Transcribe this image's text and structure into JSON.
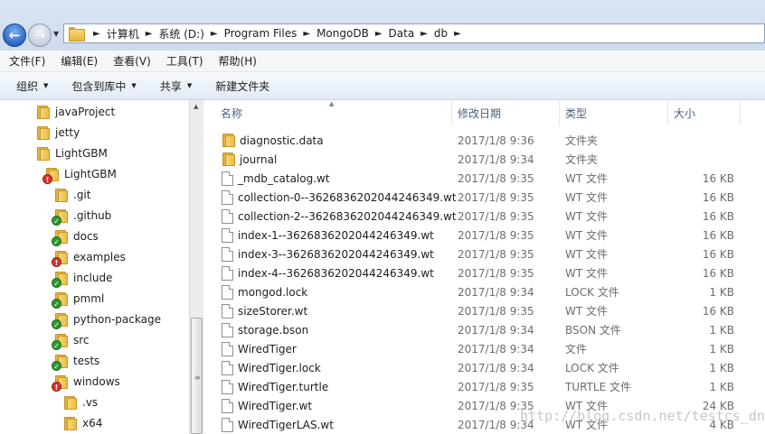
{
  "address": {
    "crumbs": [
      "计算机",
      "系统 (D:)",
      "Program Files",
      "MongoDB",
      "Data",
      "db"
    ]
  },
  "menu": [
    "文件(F)",
    "编辑(E)",
    "查看(V)",
    "工具(T)",
    "帮助(H)"
  ],
  "commands": {
    "organize": "组织",
    "include_in_library": "包含到库中",
    "share": "共享",
    "new_folder": "新建文件夹"
  },
  "columns": {
    "name": "名称",
    "date": "修改日期",
    "type": "类型",
    "size": "大小"
  },
  "tree": [
    {
      "label": "javaProject",
      "icon": "folder-icon",
      "badge": ""
    },
    {
      "label": "jetty",
      "icon": "folder-icon",
      "badge": ""
    },
    {
      "label": "LightGBM",
      "icon": "folder-icon",
      "badge": ""
    },
    {
      "label": "LightGBM",
      "icon": "folder-icon",
      "badge": "error"
    },
    {
      "label": ".git",
      "icon": "folder-icon",
      "badge": ""
    },
    {
      "label": ".github",
      "icon": "folder-icon",
      "badge": "ok"
    },
    {
      "label": "docs",
      "icon": "folder-icon",
      "badge": "ok"
    },
    {
      "label": "examples",
      "icon": "folder-icon",
      "badge": "error"
    },
    {
      "label": "include",
      "icon": "folder-icon",
      "badge": "ok"
    },
    {
      "label": "pmml",
      "icon": "folder-icon",
      "badge": "ok"
    },
    {
      "label": "python-package",
      "icon": "folder-icon",
      "badge": "ok"
    },
    {
      "label": "src",
      "icon": "folder-icon",
      "badge": "ok"
    },
    {
      "label": "tests",
      "icon": "folder-icon",
      "badge": "ok"
    },
    {
      "label": "windows",
      "icon": "folder-icon",
      "badge": "error"
    },
    {
      "label": ".vs",
      "icon": "folder-icon",
      "badge": ""
    },
    {
      "label": "x64",
      "icon": "folder-icon",
      "badge": ""
    }
  ],
  "files": [
    {
      "name": "diagnostic.data",
      "date": "2017/1/8 9:36",
      "type": "文件夹",
      "size": "",
      "icon": "folder-icon"
    },
    {
      "name": "journal",
      "date": "2017/1/8 9:34",
      "type": "文件夹",
      "size": "",
      "icon": "folder-icon"
    },
    {
      "name": "_mdb_catalog.wt",
      "date": "2017/1/8 9:35",
      "type": "WT 文件",
      "size": "16 KB",
      "icon": "file-icon"
    },
    {
      "name": "collection-0--3626836202044246349.wt",
      "date": "2017/1/8 9:35",
      "type": "WT 文件",
      "size": "16 KB",
      "icon": "file-icon"
    },
    {
      "name": "collection-2--3626836202044246349.wt",
      "date": "2017/1/8 9:35",
      "type": "WT 文件",
      "size": "16 KB",
      "icon": "file-icon"
    },
    {
      "name": "index-1--3626836202044246349.wt",
      "date": "2017/1/8 9:35",
      "type": "WT 文件",
      "size": "16 KB",
      "icon": "file-icon"
    },
    {
      "name": "index-3--3626836202044246349.wt",
      "date": "2017/1/8 9:35",
      "type": "WT 文件",
      "size": "16 KB",
      "icon": "file-icon"
    },
    {
      "name": "index-4--3626836202044246349.wt",
      "date": "2017/1/8 9:35",
      "type": "WT 文件",
      "size": "16 KB",
      "icon": "file-icon"
    },
    {
      "name": "mongod.lock",
      "date": "2017/1/8 9:34",
      "type": "LOCK 文件",
      "size": "1 KB",
      "icon": "file-icon"
    },
    {
      "name": "sizeStorer.wt",
      "date": "2017/1/8 9:35",
      "type": "WT 文件",
      "size": "16 KB",
      "icon": "file-icon"
    },
    {
      "name": "storage.bson",
      "date": "2017/1/8 9:34",
      "type": "BSON 文件",
      "size": "1 KB",
      "icon": "file-icon"
    },
    {
      "name": "WiredTiger",
      "date": "2017/1/8 9:34",
      "type": "文件",
      "size": "1 KB",
      "icon": "file-icon"
    },
    {
      "name": "WiredTiger.lock",
      "date": "2017/1/8 9:34",
      "type": "LOCK 文件",
      "size": "1 KB",
      "icon": "file-icon"
    },
    {
      "name": "WiredTiger.turtle",
      "date": "2017/1/8 9:35",
      "type": "TURTLE 文件",
      "size": "1 KB",
      "icon": "file-icon"
    },
    {
      "name": "WiredTiger.wt",
      "date": "2017/1/8 9:35",
      "type": "WT 文件",
      "size": "24 KB",
      "icon": "file-icon"
    },
    {
      "name": "WiredTigerLAS.wt",
      "date": "2017/1/8 9:34",
      "type": "WT 文件",
      "size": "4 KB",
      "icon": "file-icon"
    }
  ],
  "watermark": "http://blog.csdn.net/testcs_dn"
}
